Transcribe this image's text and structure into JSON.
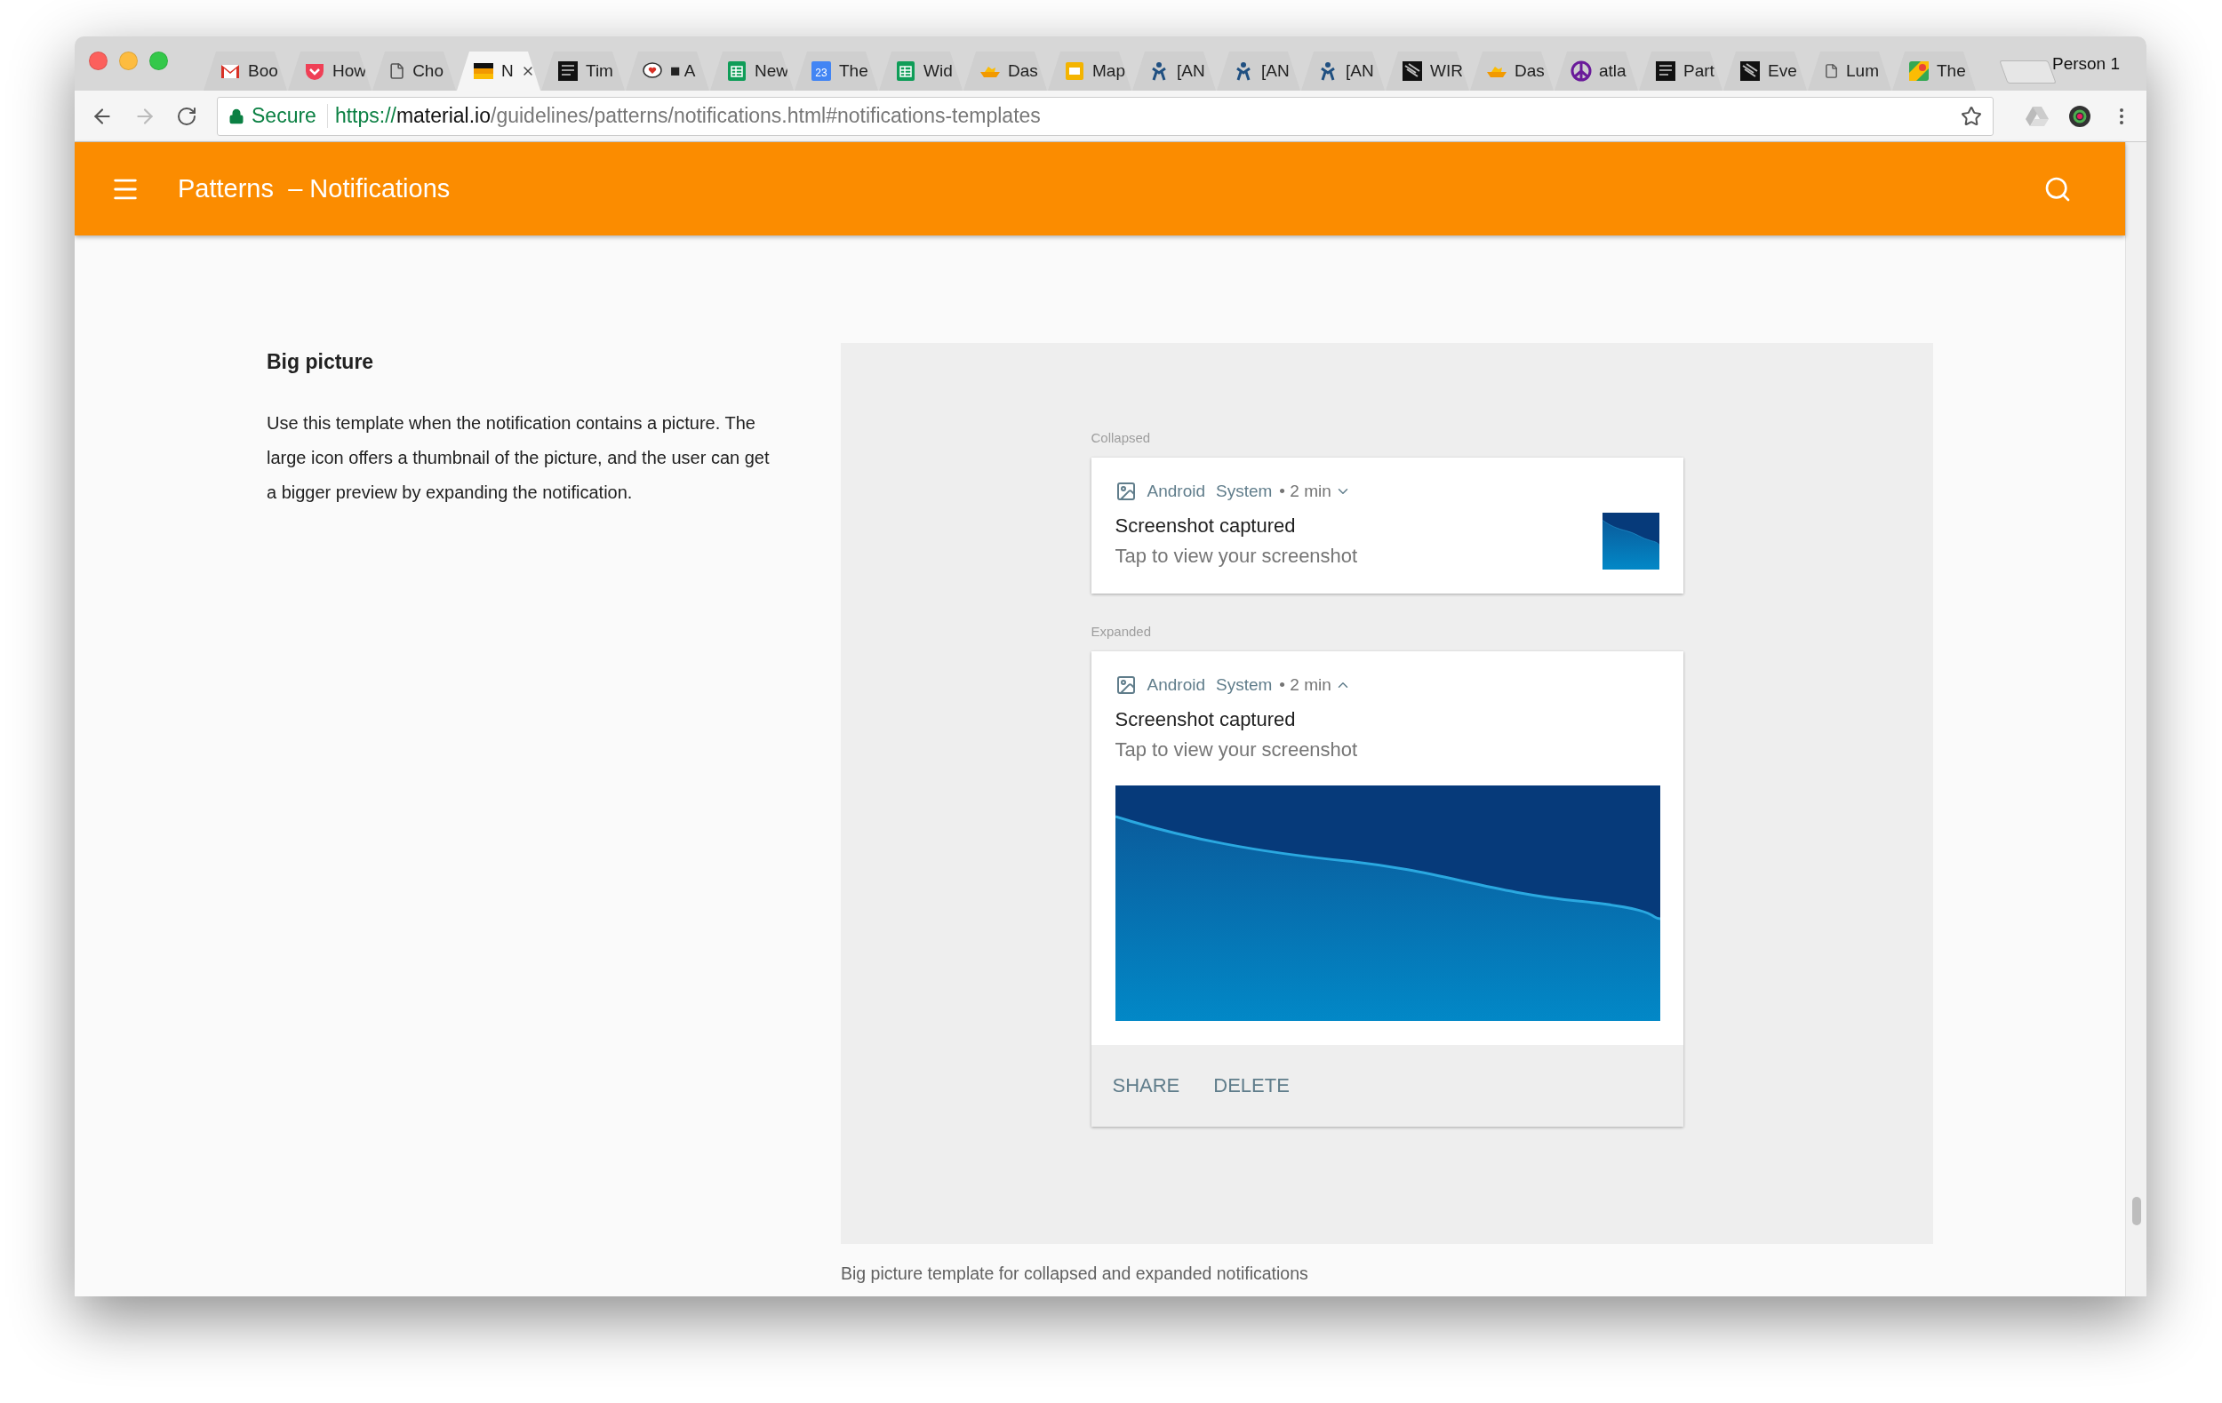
{
  "browser": {
    "tabs": [
      {
        "title": "Boo",
        "kind": "gmail",
        "selected": false
      },
      {
        "title": "How",
        "kind": "pocket",
        "selected": false
      },
      {
        "title": "Cho",
        "kind": "page",
        "selected": false
      },
      {
        "title": "N",
        "kind": "flag",
        "selected": true
      },
      {
        "title": "Tim",
        "kind": "dark",
        "selected": false
      },
      {
        "title": "■ A",
        "kind": "speech",
        "selected": false
      },
      {
        "title": "New",
        "kind": "sheet",
        "selected": false
      },
      {
        "title": "The",
        "kind": "calendar",
        "badge": "23",
        "selected": false
      },
      {
        "title": "Wid",
        "kind": "sheet",
        "selected": false
      },
      {
        "title": "Das",
        "kind": "ship",
        "selected": false
      },
      {
        "title": "Map",
        "kind": "slides",
        "selected": false
      },
      {
        "title": "[AN",
        "kind": "jira",
        "selected": false
      },
      {
        "title": "[AN",
        "kind": "jira",
        "selected": false
      },
      {
        "title": "[AN",
        "kind": "jira",
        "selected": false
      },
      {
        "title": "WIR",
        "kind": "stripes",
        "selected": false
      },
      {
        "title": "Das",
        "kind": "ship",
        "selected": false
      },
      {
        "title": "atla",
        "kind": "peace",
        "selected": false
      },
      {
        "title": "Part",
        "kind": "dark",
        "selected": false
      },
      {
        "title": "Eve",
        "kind": "stripes",
        "selected": false
      },
      {
        "title": "Lum",
        "kind": "page",
        "selected": false
      },
      {
        "title": "The",
        "kind": "maps",
        "selected": false
      }
    ],
    "profile": "Person 1",
    "address": {
      "secure_label": "Secure",
      "scheme": "https://",
      "host": "material.io",
      "path": "/guidelines/patterns/notifications.html#notifications-templates"
    }
  },
  "app_bar": {
    "section": "Patterns",
    "separator": "–",
    "page": "Notifications"
  },
  "article": {
    "heading": "Big picture",
    "paragraph": "Use this template when the notification contains a picture. The large icon offers a thumbnail of the picture, and the user can get a bigger preview by expanding the notification."
  },
  "figure": {
    "notifications": [
      {
        "label": "Collapsed",
        "expanded": false,
        "app": "Android",
        "source": "System",
        "meta": "• 2 min",
        "title": "Screenshot captured",
        "text": "Tap to view your screenshot"
      },
      {
        "label": "Expanded",
        "expanded": true,
        "app": "Android",
        "source": "System",
        "meta": "• 2 min",
        "title": "Screenshot captured",
        "text": "Tap to view your screenshot",
        "actions": [
          "SHARE",
          "DELETE"
        ]
      }
    ],
    "caption": "Big picture template for collapsed and expanded notifications"
  }
}
